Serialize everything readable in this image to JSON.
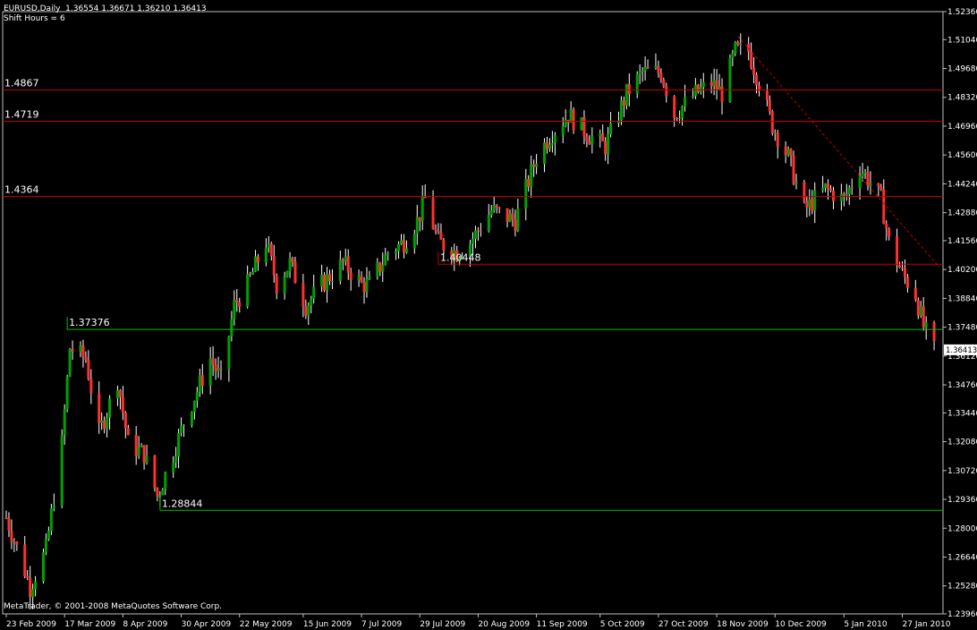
{
  "header": {
    "symbol": "EURUSD,Daily",
    "ohlc": "1.36554 1.36671 1.36210 1.36413",
    "shift": "Shift Hours = 6"
  },
  "copyright": "MetaTrader, © 2001-2008 MetaQuotes Software Corp.",
  "colors": {
    "background": "#000000",
    "axis": "#c0c0c0",
    "bull": "#00a000",
    "bear": "#ff3030",
    "wick": "#ffffff",
    "resistance": "#c80000",
    "support": "#00c000"
  },
  "chart_data": {
    "type": "candlestick",
    "symbol": "EURUSD",
    "timeframe": "Daily",
    "ylim": [
      1.2396,
      1.5236
    ],
    "y_ticks": [
      "1.52360",
      "1.51040",
      "1.49680",
      "1.48320",
      "1.46960",
      "1.45600",
      "1.44240",
      "1.42880",
      "1.41560",
      "1.40200",
      "1.38840",
      "1.37480",
      "1.36120",
      "1.34760",
      "1.33440",
      "1.32080",
      "1.30720",
      "1.29360",
      "1.28000",
      "1.26640",
      "1.25280",
      "1.23960"
    ],
    "x_ticks": [
      "23 Feb 2009",
      "17 Mar 2009",
      "8 Apr 2009",
      "30 Apr 2009",
      "22 May 2009",
      "15 Jun 2009",
      "7 Jul 2009",
      "29 Jul 2009",
      "20 Aug 2009",
      "11 Sep 2009",
      "5 Oct 2009",
      "27 Oct 2009",
      "18 Nov 2009",
      "10 Dec 2009",
      "5 Jan 2010",
      "27 Jan 2010"
    ],
    "current_price": "1.36413",
    "price_path": [
      [
        "23 Feb 2009",
        1.285
      ],
      [
        "2 Mar 2009",
        1.26
      ],
      [
        "4 Mar 2009",
        1.252
      ],
      [
        "10 Mar 2009",
        1.27
      ],
      [
        "13 Mar 2009",
        1.295
      ],
      [
        "16 Mar 2009",
        1.32
      ],
      [
        "19 Mar 2009",
        1.365
      ],
      [
        "25 Mar 2009",
        1.36
      ],
      [
        "30 Mar 2009",
        1.325
      ],
      [
        "2 Apr 2009",
        1.335
      ],
      [
        "6 Apr 2009",
        1.35
      ],
      [
        "10 Apr 2009",
        1.32
      ],
      [
        "16 Apr 2009",
        1.315
      ],
      [
        "21 Apr 2009",
        1.295
      ],
      [
        "27 Apr 2009",
        1.315
      ],
      [
        "1 May 2009",
        1.33
      ],
      [
        "6 May 2009",
        1.345
      ],
      [
        "11 May 2009",
        1.36
      ],
      [
        "15 May 2009",
        1.35
      ],
      [
        "20 May 2009",
        1.385
      ],
      [
        "25 May 2009",
        1.395
      ],
      [
        "1 Jun 2009",
        1.415
      ],
      [
        "5 Jun 2009",
        1.395
      ],
      [
        "10 Jun 2009",
        1.405
      ],
      [
        "16 Jun 2009",
        1.385
      ],
      [
        "22 Jun 2009",
        1.395
      ],
      [
        "30 Jun 2009",
        1.405
      ],
      [
        "7 Jul 2009",
        1.395
      ],
      [
        "10 Jul 2009",
        1.395
      ],
      [
        "17 Jul 2009",
        1.41
      ],
      [
        "23 Jul 2009",
        1.415
      ],
      [
        "28 Jul 2009",
        1.425
      ],
      [
        "31 Jul 2009",
        1.435
      ],
      [
        "5 Aug 2009",
        1.415
      ],
      [
        "12 Aug 2009",
        1.41
      ],
      [
        "17 Aug 2009",
        1.415
      ],
      [
        "25 Aug 2009",
        1.43
      ],
      [
        "3 Sep 2009",
        1.425
      ],
      [
        "11 Sep 2009",
        1.455
      ],
      [
        "16 Sep 2009",
        1.465
      ],
      [
        "23 Sep 2009",
        1.475
      ],
      [
        "1 Oct 2009",
        1.465
      ],
      [
        "7 Oct 2009",
        1.46
      ],
      [
        "15 Oct 2009",
        1.485
      ],
      [
        "21 Oct 2009",
        1.495
      ],
      [
        "28 Oct 2009",
        1.495
      ],
      [
        "2 Nov 2009",
        1.475
      ],
      [
        "10 Nov 2009",
        1.485
      ],
      [
        "16 Nov 2009",
        1.49
      ],
      [
        "20 Nov 2009",
        1.485
      ],
      [
        "25 Nov 2009",
        1.505
      ],
      [
        "30 Nov 2009",
        1.505
      ],
      [
        "4 Dec 2009",
        1.49
      ],
      [
        "9 Dec 2009",
        1.47
      ],
      [
        "15 Dec 2009",
        1.455
      ],
      [
        "21 Dec 2009",
        1.43
      ],
      [
        "29 Dec 2009",
        1.44
      ],
      [
        "5 Jan 2010",
        1.435
      ],
      [
        "11 Jan 2010",
        1.45
      ],
      [
        "14 Jan 2010",
        1.445
      ],
      [
        "19 Jan 2010",
        1.435
      ],
      [
        "22 Jan 2010",
        1.415
      ],
      [
        "27 Jan 2010",
        1.4
      ],
      [
        "1 Feb 2010",
        1.39
      ],
      [
        "4 Feb 2010",
        1.375
      ],
      [
        "8 Feb 2010",
        1.364
      ]
    ],
    "horizontal_lines": [
      {
        "label": "1.4867",
        "value": 1.4867,
        "role": "resistance"
      },
      {
        "label": "1.4719",
        "value": 1.4719,
        "role": "resistance"
      },
      {
        "label": "1.4364",
        "value": 1.4364,
        "role": "resistance"
      },
      {
        "label": "1.40448",
        "value": 1.40448,
        "role": "resistance",
        "from": "5 Aug 2009"
      },
      {
        "label": "1.37376",
        "value": 1.37376,
        "role": "support",
        "from": "18 Mar 2009"
      },
      {
        "label": "1.28844",
        "value": 1.28844,
        "role": "support",
        "from": "22 Apr 2009"
      }
    ],
    "trendline": {
      "style": "dashed",
      "from": [
        "26 Nov 2009",
        1.512
      ],
      "to": [
        "10 Feb 2010",
        1.403
      ]
    }
  }
}
